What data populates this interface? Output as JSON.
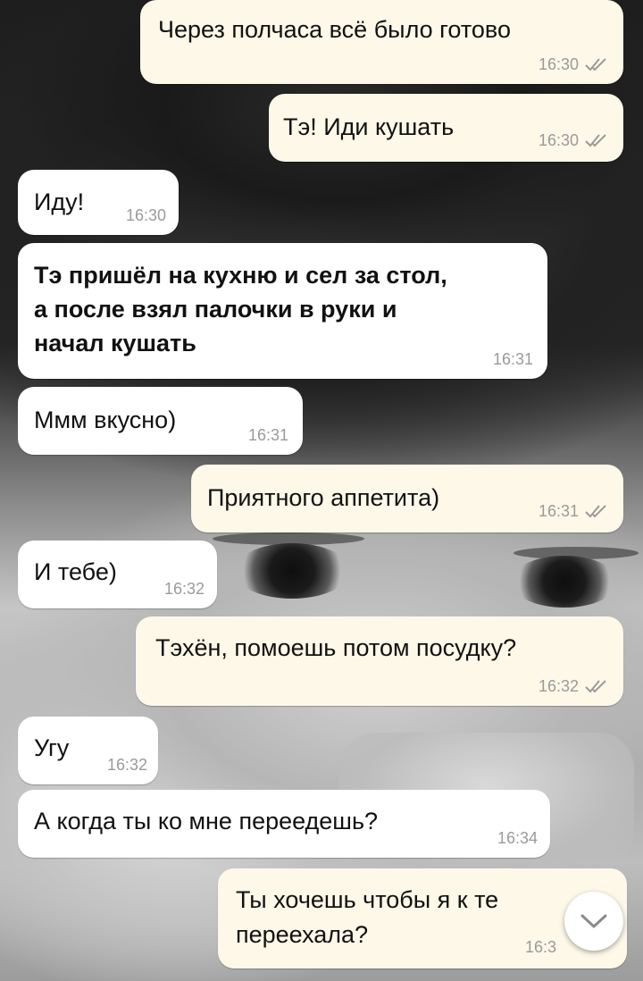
{
  "messages": [
    {
      "dir": "out",
      "text": "Через полчаса всё было готово",
      "time": "16:30",
      "status": "read-double-check-icon"
    },
    {
      "dir": "out",
      "text": "Тэ! Иди кушать",
      "time": "16:30",
      "status": "read-double-check-icon"
    },
    {
      "dir": "in",
      "text": "Иду!",
      "time": "16:30"
    },
    {
      "dir": "in",
      "text": "Тэ пришёл на кухню и сел за стол,\nа после взял палочки в руки и\nначал кушать",
      "time": "16:31",
      "bold": true
    },
    {
      "dir": "in",
      "text": "Ммм вкусно)",
      "time": "16:31"
    },
    {
      "dir": "out",
      "text": "Приятного аппетита)",
      "time": "16:31",
      "status": "read-double-check-icon"
    },
    {
      "dir": "in",
      "text": "И тебе)",
      "time": "16:32"
    },
    {
      "dir": "out",
      "text": "Тэхён, помоешь потом посудку?",
      "time": "16:32",
      "status": "read-double-check-icon"
    },
    {
      "dir": "in",
      "text": "Угу",
      "time": "16:32"
    },
    {
      "dir": "in",
      "text": "А когда ты ко мне переедешь?",
      "time": "16:34"
    },
    {
      "dir": "out",
      "text": "Ты хочешь чтобы я к те\nпереехала?",
      "time": "16:3"
    }
  ],
  "scroll_button": {
    "icon": "chevron-down-icon"
  },
  "colors": {
    "outgoing_bubble": "#fdf8e8",
    "incoming_bubble": "#ffffff",
    "meta_text": "#9a9a9a",
    "read_ticks": "#9a9a9a"
  }
}
